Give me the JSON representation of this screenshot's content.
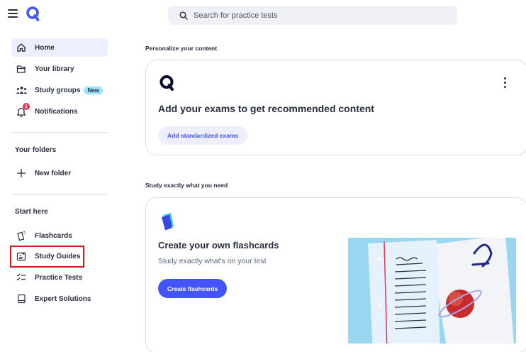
{
  "sidebar": {
    "nav": [
      {
        "label": "Home",
        "icon": "home-icon"
      },
      {
        "label": "Your library",
        "icon": "folder-icon"
      },
      {
        "label": "Study groups",
        "icon": "users-icon",
        "badge": "New"
      },
      {
        "label": "Notifications",
        "icon": "bell-icon",
        "count": "1"
      }
    ],
    "folders_heading": "Your folders",
    "new_folder": "New folder",
    "start_heading": "Start here",
    "start_items": [
      {
        "label": "Flashcards",
        "icon": "flashcards-icon"
      },
      {
        "label": "Study Guides",
        "icon": "study-guide-icon"
      },
      {
        "label": "Practice Tests",
        "icon": "checklist-icon"
      },
      {
        "label": "Expert Solutions",
        "icon": "book-icon"
      }
    ]
  },
  "search": {
    "placeholder": "Search for practice tests"
  },
  "main": {
    "section1_heading": "Personalize your content",
    "card1": {
      "title": "Add your exams to get recommended content",
      "button": "Add standardized exams"
    },
    "section2_heading": "Study exactly what you need",
    "card2": {
      "title": "Create your own flashcards",
      "subtitle": "Study exactly what's on your test",
      "button": "Create flashcards"
    }
  },
  "colors": {
    "accent": "#4255ff",
    "active_bg": "#edeffe",
    "badge": "#98e3ff",
    "highlight": "#e0141e",
    "notification": "#e8345b"
  }
}
